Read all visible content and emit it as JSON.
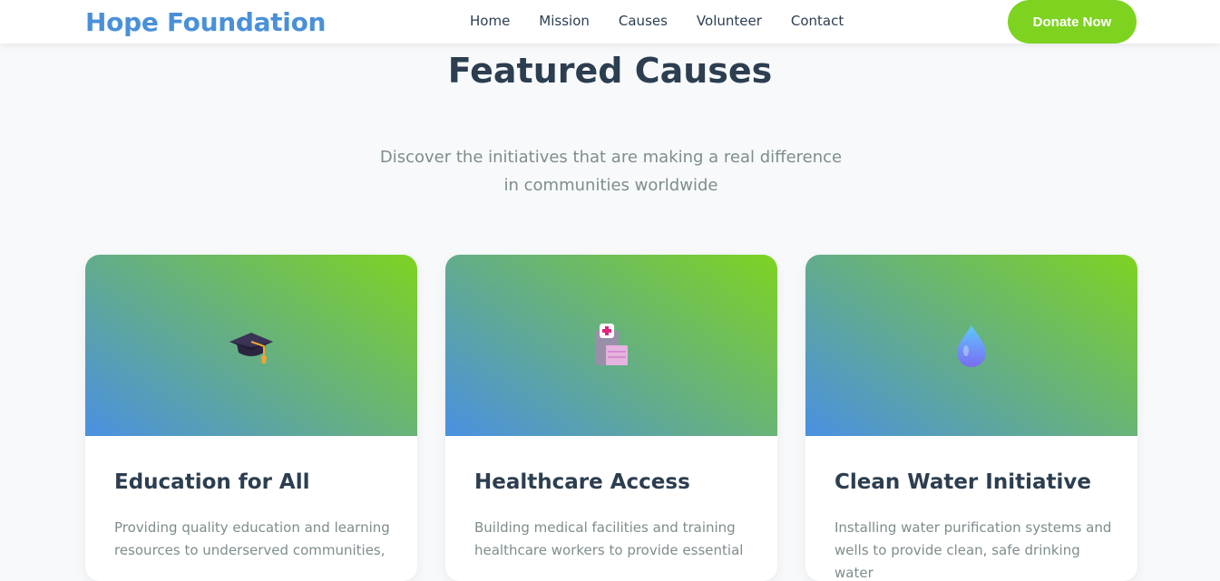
{
  "header": {
    "logo": "Hope Foundation",
    "nav": [
      "Home",
      "Mission",
      "Causes",
      "Volunteer",
      "Contact"
    ],
    "cta": "Donate Now"
  },
  "section": {
    "title": "Featured Causes",
    "subtitle": "Discover the initiatives that are making a real difference in communities worldwide"
  },
  "causes": [
    {
      "icon": "graduation-cap-icon",
      "title": "Education for All",
      "description": "Providing quality education and learning resources to underserved communities,"
    },
    {
      "icon": "hospital-icon",
      "title": "Healthcare Access",
      "description": "Building medical facilities and training healthcare workers to provide essential"
    },
    {
      "icon": "water-drop-icon",
      "title": "Clean Water Initiative",
      "description": "Installing water purification systems and wells to provide clean, safe drinking water"
    }
  ],
  "colors": {
    "brand": "#4a90d9",
    "accent": "#7ed321",
    "heading": "#2c3e50",
    "muted": "#7f8c8d"
  }
}
